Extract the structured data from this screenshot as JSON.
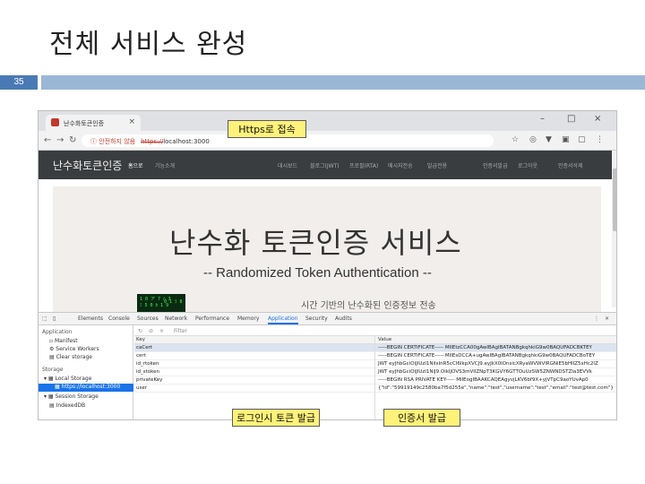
{
  "slide": {
    "title": "전체 서비스 완성",
    "number": "35",
    "colors": {
      "number_bg": "#4a7ab5",
      "bar": "#9bb7d6",
      "callout": "#fff27a"
    }
  },
  "browser": {
    "tab_title": "난수화토큰인증",
    "tab_close": "×",
    "window_controls": [
      "–",
      "□",
      "×"
    ],
    "url_warning": "ⓘ 안전하지 않음",
    "url_scheme": "https://",
    "url_host": "localhost:3000",
    "nav_icons": [
      "arrow-left-icon",
      "arrow-right-icon",
      "reload-icon"
    ]
  },
  "site": {
    "brand": "난수화토큰인증",
    "nav": [
      "홈으로",
      "기능소개",
      "대시보드",
      "블로그(JWT)",
      "프로필(RTA)",
      "메시지전송",
      "발급전용",
      "인증서발급",
      "로그아웃",
      "인증서삭제"
    ],
    "active_nav": 0,
    "hero_title": "난수화 토큰인증 서비스",
    "hero_subtitle": "-- Randomized Token Authentication --",
    "hero_desc": "시간 기반의 난수화된 인증정보 전송"
  },
  "devtools": {
    "tabs": [
      "Elements",
      "Console",
      "Sources",
      "Network",
      "Performance",
      "Memory",
      "Application",
      "Security",
      "Audits"
    ],
    "active_tab": "Application",
    "filter_placeholder": "Filter",
    "sidebar": {
      "application_header": "Application",
      "application_items": [
        "Manifest",
        "Service Workers",
        "Clear storage"
      ],
      "storage_header": "Storage",
      "local_storage": "Local Storage",
      "local_storage_selected": "https://localhost:3000",
      "session_storage": "Session Storage",
      "indexed_db": "IndexedDB"
    },
    "columns": [
      "Key",
      "Value"
    ],
    "rows": [
      {
        "key": "caCert",
        "value": "-----BEGIN CERTIFICATE----- MIIEtzCCA00gAwIBAgIBATANBgkqhkiG9w0BAQUFADCBKTEY"
      },
      {
        "key": "cert",
        "value": "-----BEGIN CERTIFICATE----- MIIEsDCCA+ugAwIBAgIBATANBgkqhkiG9w0BAQUFADCBoTEY"
      },
      {
        "key": "id_rtoken",
        "value": "JWT eyJhbGciOiJIUzI1NiIsInR5cCI6IkpXVCJ9.eyJkX0lOnsicXRyaWVWVlRGNiE5bHlIZ5xHc2lZ"
      },
      {
        "key": "id_stoken",
        "value": "JWT eyJhbGciOiJIUzI1NiJ9.OikIJOVS3mVlIZNpT3KGVY6GTTOuUzSW5ZNWNDSTZIa3EVVk"
      },
      {
        "key": "privateKey",
        "value": "-----BEGIN RSA PRIVATE KEY----- MIIEogIBAAKCAQEAgyvjLKV6bf9X+yjVTpC9aoYUvAp0"
      },
      {
        "key": "user",
        "value": "{\"id\":\"59919149c2580ba7f5d255e\",\"name\":\"test\",\"username\":\"test\",\"email\":\"test@test.com\"}"
      }
    ],
    "selected_row": 0
  },
  "callouts": {
    "https": "Https로 접속",
    "login_token": "로그인시 토큰 발급",
    "cert_issue": "인증서 발급"
  }
}
